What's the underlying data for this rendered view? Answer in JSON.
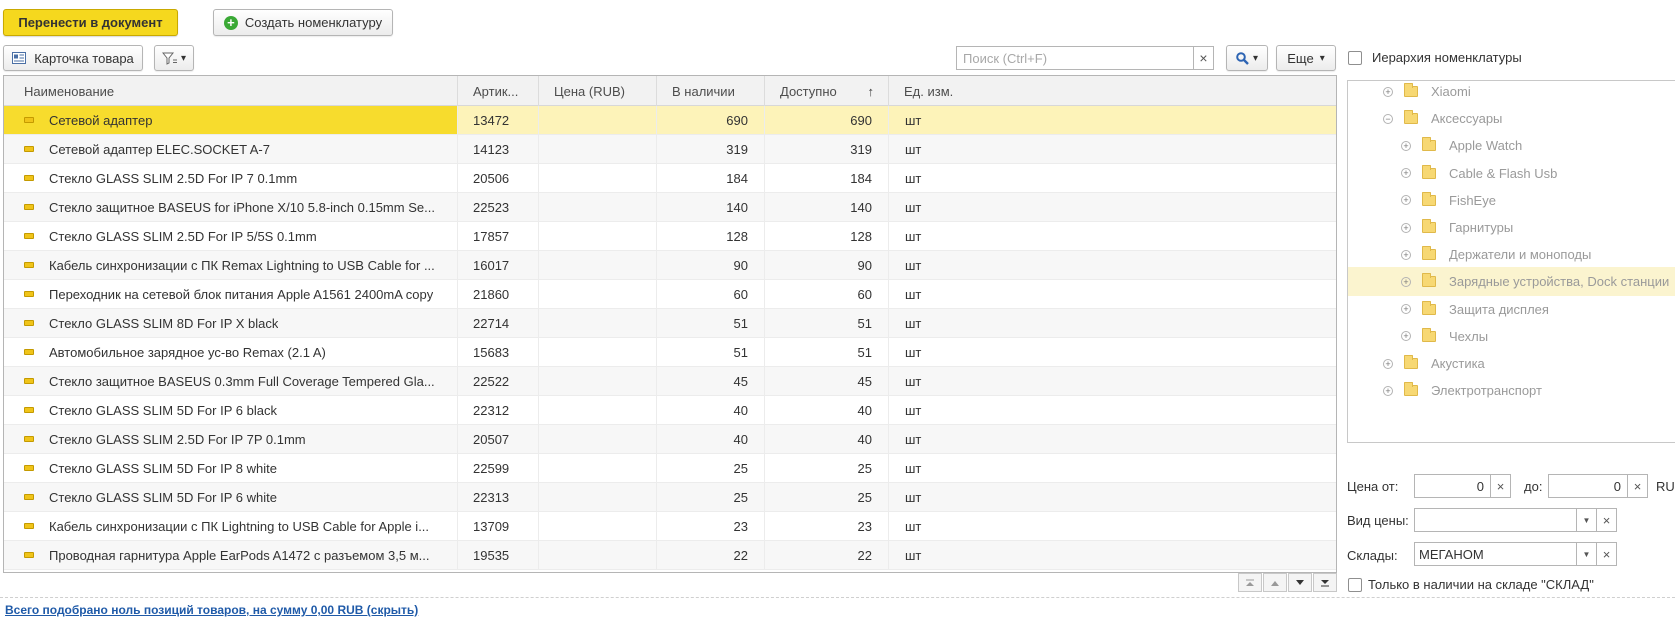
{
  "toolbar": {
    "transfer_label": "Перенести в документ",
    "create_label": "Создать номенклатуру",
    "card_label": "Карточка товара",
    "search_placeholder": "Поиск (Ctrl+F)",
    "more_label": "Еще",
    "hierarchy_label": "Иерархия номенклатуры"
  },
  "table": {
    "columns": [
      "Наименование",
      "Артик...",
      "Цена (RUB)",
      "В наличии",
      "Доступно",
      "Ед. изм."
    ],
    "sort_indicator": "↑",
    "rows": [
      {
        "name": "Сетевой адаптер",
        "article": "13472",
        "price": "",
        "stock": "690",
        "available": "690",
        "unit": "шт"
      },
      {
        "name": "Сетевой адаптер ELEC.SOCKET A-7",
        "article": "14123",
        "price": "",
        "stock": "319",
        "available": "319",
        "unit": "шт"
      },
      {
        "name": "Стекло GLASS SLIM 2.5D For IP 7 0.1mm",
        "article": "20506",
        "price": "",
        "stock": "184",
        "available": "184",
        "unit": "шт"
      },
      {
        "name": "Стекло защитное BASEUS for iPhone X/10 5.8-inch 0.15mm Se...",
        "article": "22523",
        "price": "",
        "stock": "140",
        "available": "140",
        "unit": "шт"
      },
      {
        "name": "Стекло GLASS SLIM 2.5D For IP 5/5S 0.1mm",
        "article": "17857",
        "price": "",
        "stock": "128",
        "available": "128",
        "unit": "шт"
      },
      {
        "name": "Кабель синхронизации с ПК Remax Lightning to USB Cable for ...",
        "article": "16017",
        "price": "",
        "stock": "90",
        "available": "90",
        "unit": "шт"
      },
      {
        "name": "Переходник на сетевой блок питания Apple A1561 2400mA copy",
        "article": "21860",
        "price": "",
        "stock": "60",
        "available": "60",
        "unit": "шт"
      },
      {
        "name": "Стекло GLASS SLIM 8D For IP X black",
        "article": "22714",
        "price": "",
        "stock": "51",
        "available": "51",
        "unit": "шт"
      },
      {
        "name": "Автомобильное зарядное ус-во Remax  (2.1 A)",
        "article": "15683",
        "price": "",
        "stock": "51",
        "available": "51",
        "unit": "шт"
      },
      {
        "name": "Стекло защитное BASEUS 0.3mm Full Coverage Tempered Gla...",
        "article": "22522",
        "price": "",
        "stock": "45",
        "available": "45",
        "unit": "шт"
      },
      {
        "name": "Стекло GLASS SLIM 5D For IP 6 black",
        "article": "22312",
        "price": "",
        "stock": "40",
        "available": "40",
        "unit": "шт"
      },
      {
        "name": "Стекло GLASS SLIM 2.5D For IP 7P 0.1mm",
        "article": "20507",
        "price": "",
        "stock": "40",
        "available": "40",
        "unit": "шт"
      },
      {
        "name": "Стекло GLASS SLIM 5D For IP 8 white",
        "article": "22599",
        "price": "",
        "stock": "25",
        "available": "25",
        "unit": "шт"
      },
      {
        "name": "Стекло GLASS SLIM 5D For IP 6 white",
        "article": "22313",
        "price": "",
        "stock": "25",
        "available": "25",
        "unit": "шт"
      },
      {
        "name": "Кабель синхронизации с ПК Lightning to USB Cable for Apple i...",
        "article": "13709",
        "price": "",
        "stock": "23",
        "available": "23",
        "unit": "шт"
      },
      {
        "name": "Проводная гарнитура Apple EarPods A1472 с разъемом 3,5 м...",
        "article": "19535",
        "price": "",
        "stock": "22",
        "available": "22",
        "unit": "шт"
      }
    ]
  },
  "tree": {
    "items": [
      {
        "label": "Xiaomi",
        "level": 1,
        "expander": "+"
      },
      {
        "label": "Аксессуары",
        "level": 1,
        "expander": "−"
      },
      {
        "label": "Apple Watch",
        "level": 2,
        "expander": "+"
      },
      {
        "label": "Cable & Flash Usb",
        "level": 2,
        "expander": "+"
      },
      {
        "label": "FishEye",
        "level": 2,
        "expander": "+"
      },
      {
        "label": "Гарнитуры",
        "level": 2,
        "expander": "+"
      },
      {
        "label": "Держатели и моноподы",
        "level": 2,
        "expander": "+"
      },
      {
        "label": "Зарядные устройства, Dock станции",
        "level": 2,
        "expander": "+"
      },
      {
        "label": "Защита дисплея",
        "level": 2,
        "expander": "+"
      },
      {
        "label": "Чехлы",
        "level": 2,
        "expander": "+"
      },
      {
        "label": "Акустика",
        "level": 1,
        "expander": "+"
      },
      {
        "label": "Электротранспорт",
        "level": 1,
        "expander": "+"
      }
    ]
  },
  "filters": {
    "price_from_label": "Цена от:",
    "price_from_value": "0",
    "price_to_label": "до:",
    "price_to_value": "0",
    "currency": "RUB",
    "price_type_label": "Вид цены:",
    "price_type_value": "",
    "warehouse_label": "Склады:",
    "warehouse_value": "МЕГАНОМ",
    "only_in_stock_label": "Только в наличии на складе \"СКЛАД\""
  },
  "summary": "Всего подобрано ноль позиций товаров, на сумму 0,00 RUB (скрыть)",
  "colors": {
    "accent_yellow": "#f5d81e",
    "selected_row": "#fdf3b9",
    "link_blue": "#1f5aa8",
    "icon_green": "#3aa935"
  }
}
